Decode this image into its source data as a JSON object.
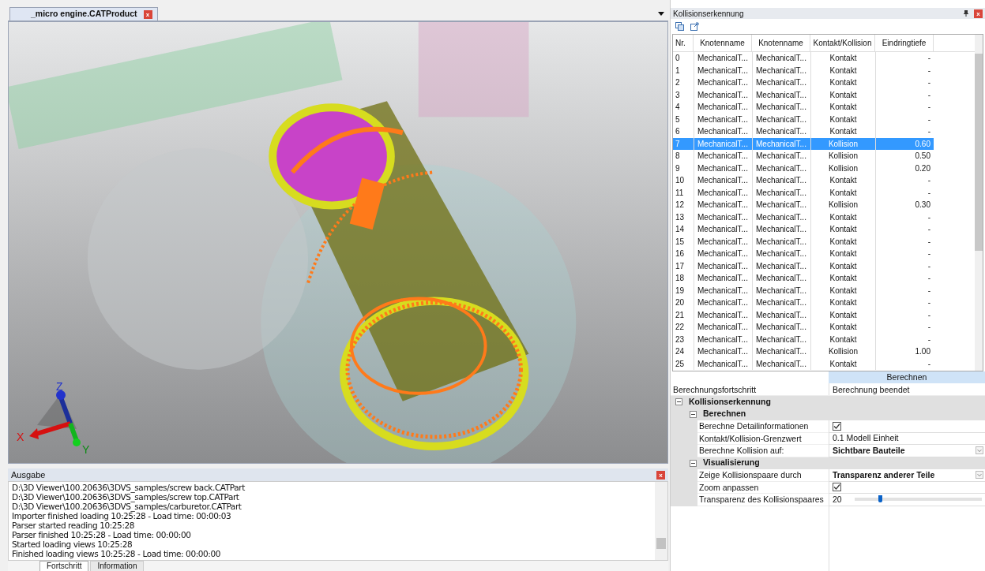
{
  "document_tab": {
    "label": "_micro engine.CATProduct",
    "close": "x"
  },
  "viewport": {
    "kind": "picture",
    "axes": [
      "Z",
      "X",
      "Y"
    ]
  },
  "output_panel": {
    "title": "Ausgabe",
    "close": "x",
    "lines": [
      "D:\\3D Viewer\\100.20636\\3DVS_samples/screw back.CATPart",
      "D:\\3D Viewer\\100.20636\\3DVS_samples/screw top.CATPart",
      "D:\\3D Viewer\\100.20636\\3DVS_samples/carburetor.CATPart",
      "Importer finished loading 10:25:28 - Load time: 00:00:03",
      "Parser started reading  10:25:28",
      "Parser finished 10:25:28 - Load time: 00:00:00",
      "Started loading views  10:25:28",
      "Finished loading views 10:25:28 - Load time: 00:00:00"
    ],
    "tabs": [
      {
        "label": "Fortschritt",
        "selected": true
      },
      {
        "label": "Information",
        "selected": false
      }
    ]
  },
  "collision_panel": {
    "title": "Kollisionserkennung",
    "close": "x",
    "table": {
      "columns": [
        "Nr.",
        "Knotenname",
        "Knotenname",
        "Kontakt/Kollision",
        "Eindringtiefe"
      ],
      "rows": [
        {
          "nr": "0",
          "a": "MechanicalT...",
          "b": "MechanicalT...",
          "type": "Kontakt",
          "depth": "-",
          "selected": false
        },
        {
          "nr": "1",
          "a": "MechanicalT...",
          "b": "MechanicalT...",
          "type": "Kontakt",
          "depth": "-",
          "selected": false
        },
        {
          "nr": "2",
          "a": "MechanicalT...",
          "b": "MechanicalT...",
          "type": "Kontakt",
          "depth": "-",
          "selected": false
        },
        {
          "nr": "3",
          "a": "MechanicalT...",
          "b": "MechanicalT...",
          "type": "Kontakt",
          "depth": "-",
          "selected": false
        },
        {
          "nr": "4",
          "a": "MechanicalT...",
          "b": "MechanicalT...",
          "type": "Kontakt",
          "depth": "-",
          "selected": false
        },
        {
          "nr": "5",
          "a": "MechanicalT...",
          "b": "MechanicalT...",
          "type": "Kontakt",
          "depth": "-",
          "selected": false
        },
        {
          "nr": "6",
          "a": "MechanicalT...",
          "b": "MechanicalT...",
          "type": "Kontakt",
          "depth": "-",
          "selected": false
        },
        {
          "nr": "7",
          "a": "MechanicalT...",
          "b": "MechanicalT...",
          "type": "Kollision",
          "depth": "0.60",
          "selected": true
        },
        {
          "nr": "8",
          "a": "MechanicalT...",
          "b": "MechanicalT...",
          "type": "Kollision",
          "depth": "0.50",
          "selected": false
        },
        {
          "nr": "9",
          "a": "MechanicalT...",
          "b": "MechanicalT...",
          "type": "Kollision",
          "depth": "0.20",
          "selected": false
        },
        {
          "nr": "10",
          "a": "MechanicalT...",
          "b": "MechanicalT...",
          "type": "Kontakt",
          "depth": "-",
          "selected": false
        },
        {
          "nr": "11",
          "a": "MechanicalT...",
          "b": "MechanicalT...",
          "type": "Kontakt",
          "depth": "-",
          "selected": false
        },
        {
          "nr": "12",
          "a": "MechanicalT...",
          "b": "MechanicalT...",
          "type": "Kollision",
          "depth": "0.30",
          "selected": false
        },
        {
          "nr": "13",
          "a": "MechanicalT...",
          "b": "MechanicalT...",
          "type": "Kontakt",
          "depth": "-",
          "selected": false
        },
        {
          "nr": "14",
          "a": "MechanicalT...",
          "b": "MechanicalT...",
          "type": "Kontakt",
          "depth": "-",
          "selected": false
        },
        {
          "nr": "15",
          "a": "MechanicalT...",
          "b": "MechanicalT...",
          "type": "Kontakt",
          "depth": "-",
          "selected": false
        },
        {
          "nr": "16",
          "a": "MechanicalT...",
          "b": "MechanicalT...",
          "type": "Kontakt",
          "depth": "-",
          "selected": false
        },
        {
          "nr": "17",
          "a": "MechanicalT...",
          "b": "MechanicalT...",
          "type": "Kontakt",
          "depth": "-",
          "selected": false
        },
        {
          "nr": "18",
          "a": "MechanicalT...",
          "b": "MechanicalT...",
          "type": "Kontakt",
          "depth": "-",
          "selected": false
        },
        {
          "nr": "19",
          "a": "MechanicalT...",
          "b": "MechanicalT...",
          "type": "Kontakt",
          "depth": "-",
          "selected": false
        },
        {
          "nr": "20",
          "a": "MechanicalT...",
          "b": "MechanicalT...",
          "type": "Kontakt",
          "depth": "-",
          "selected": false
        },
        {
          "nr": "21",
          "a": "MechanicalT...",
          "b": "MechanicalT...",
          "type": "Kontakt",
          "depth": "-",
          "selected": false
        },
        {
          "nr": "22",
          "a": "MechanicalT...",
          "b": "MechanicalT...",
          "type": "Kontakt",
          "depth": "-",
          "selected": false
        },
        {
          "nr": "23",
          "a": "MechanicalT...",
          "b": "MechanicalT...",
          "type": "Kontakt",
          "depth": "-",
          "selected": false
        },
        {
          "nr": "24",
          "a": "MechanicalT...",
          "b": "MechanicalT...",
          "type": "Kollision",
          "depth": "1.00",
          "selected": false
        },
        {
          "nr": "25",
          "a": "MechanicalT...",
          "b": "MechanicalT...",
          "type": "Kontakt",
          "depth": "-",
          "selected": false
        }
      ]
    },
    "action_header": "Berechnen",
    "properties": {
      "progress": {
        "label": "Berechnungsfortschritt",
        "value": "Berechnung beendet"
      },
      "category": {
        "label": "Kollisionserkennung",
        "expanded": true,
        "children": [
          {
            "label": "Berechnen",
            "expanded": true,
            "children": [
              {
                "kind": "checkbox",
                "label": "Berechne Detailinformationen",
                "checked": true
              },
              {
                "kind": "text",
                "label": "Kontakt/Kollision-Grenzwert",
                "value": "0.1 Modell Einheit"
              },
              {
                "kind": "dropdown",
                "label": "Berechne Kollision auf:",
                "value": "Sichtbare Bauteile"
              }
            ]
          },
          {
            "label": "Visualisierung",
            "expanded": true,
            "children": [
              {
                "kind": "dropdown",
                "label": "Zeige Kollisionspaare durch",
                "value": "Transparenz anderer Teile"
              },
              {
                "kind": "checkbox",
                "label": "Zoom anpassen",
                "checked": true
              },
              {
                "kind": "slider",
                "label": "Transparenz des Kollisionspaares",
                "value": "20",
                "level": 0.2
              }
            ]
          }
        ]
      }
    }
  }
}
